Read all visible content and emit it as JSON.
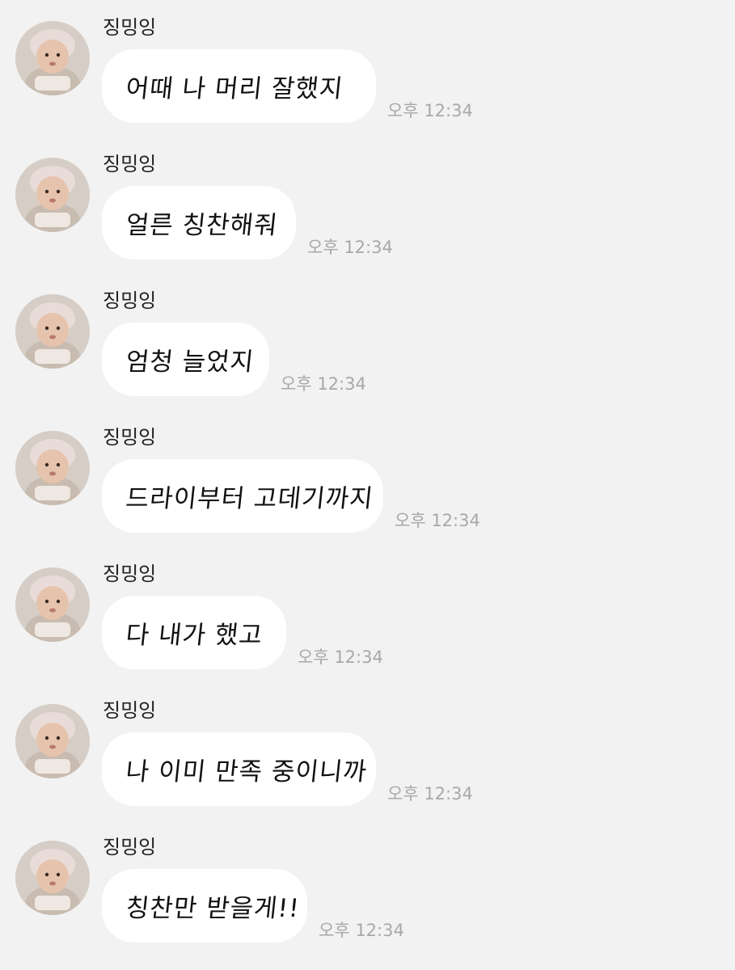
{
  "messages": [
    {
      "sender": "징밍잉",
      "text": "어때 나 머리 잘했지",
      "time": "오후 12:34"
    },
    {
      "sender": "징밍잉",
      "text": "얼른 칭찬해줘",
      "time": "오후 12:34"
    },
    {
      "sender": "징밍잉",
      "text": "엄청 늘었지",
      "time": "오후 12:34"
    },
    {
      "sender": "징밍잉",
      "text": "드라이부터 고데기까지",
      "time": "오후 12:34"
    },
    {
      "sender": "징밍잉",
      "text": "다 내가 했고",
      "time": "오후 12:34"
    },
    {
      "sender": "징밍잉",
      "text": "나 이미 만족 중이니까",
      "time": "오후 12:34"
    },
    {
      "sender": "징밍잉",
      "text": "칭찬만 받을게!!",
      "time": "오후 12:34"
    }
  ],
  "colors": {
    "background": "#f2f2f2",
    "bubble": "#ffffff",
    "timestamp": "#a8a8a8"
  },
  "icons": {
    "avatar": "baby-profile-photo"
  }
}
